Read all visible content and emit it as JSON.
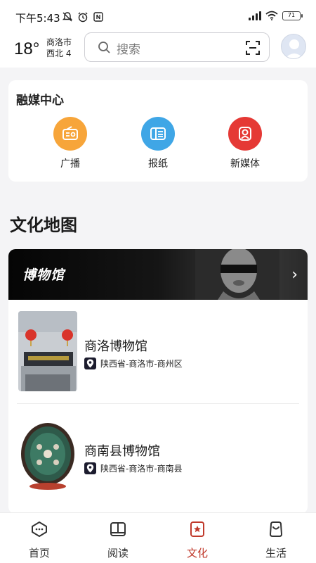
{
  "status_bar": {
    "time": "下午5:43",
    "battery": "71"
  },
  "header": {
    "temperature": "18°",
    "city": "商洛市",
    "wind": "西北 4",
    "search_placeholder": "搜索"
  },
  "media_center": {
    "title": "融媒中心",
    "items": [
      {
        "label": "广播",
        "icon": "radio-icon",
        "color": "#f7a53a"
      },
      {
        "label": "报纸",
        "icon": "newspaper-icon",
        "color": "#3fa6e6"
      },
      {
        "label": "新媒体",
        "icon": "new-media-icon",
        "color": "#e53935"
      }
    ]
  },
  "culture_map": {
    "title": "文化地图",
    "banner_title": "博物馆",
    "museums": [
      {
        "name": "商洛博物馆",
        "location": "陕西省-商洛市-商州区"
      },
      {
        "name": "商南县博物馆",
        "location": "陕西省-商洛市-商南县"
      }
    ]
  },
  "tabs": [
    {
      "label": "首页",
      "icon": "home-icon",
      "active": false
    },
    {
      "label": "阅读",
      "icon": "book-icon",
      "active": false
    },
    {
      "label": "文化",
      "icon": "culture-icon",
      "active": true
    },
    {
      "label": "生活",
      "icon": "life-icon",
      "active": false
    }
  ],
  "colors": {
    "accent": "#c0392b",
    "banner_bg": "#0b0b0b"
  }
}
